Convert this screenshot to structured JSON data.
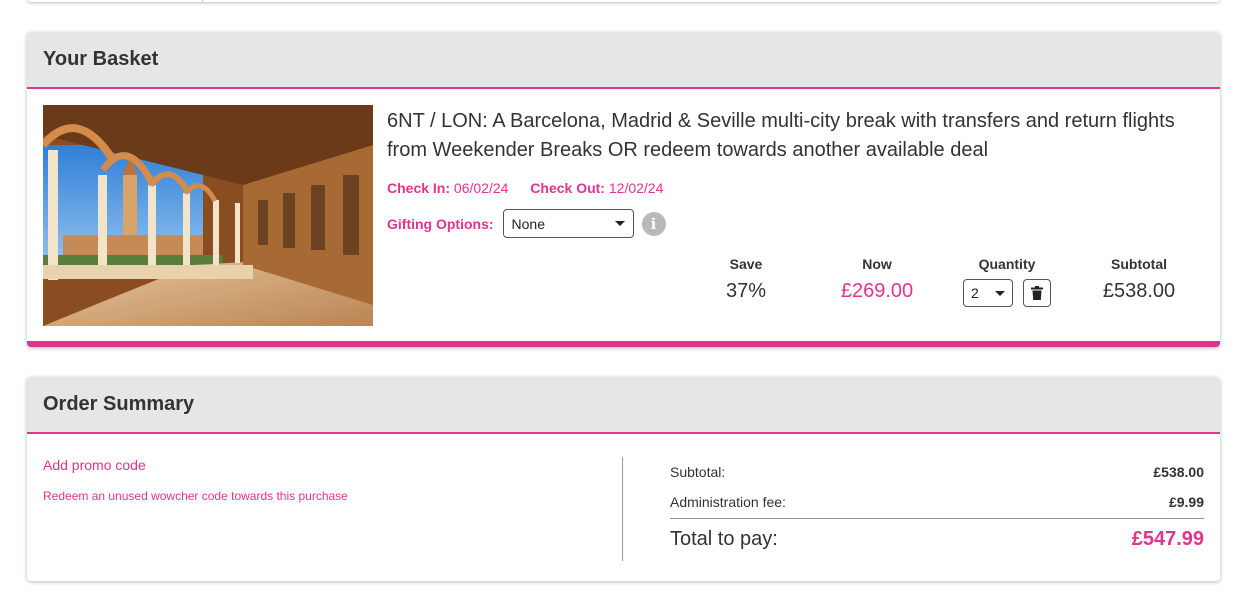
{
  "basket": {
    "header": "Your Basket",
    "deal_title": "6NT / LON: A Barcelona, Madrid & Seville multi-city break with transfers and return flights from Weekender Breaks OR redeem towards another available deal",
    "check_in_label": "Check In:",
    "check_in_value": "06/02/24",
    "check_out_label": "Check Out:",
    "check_out_value": "12/02/24",
    "gifting_label": "Gifting Options:",
    "gifting_selected": "None",
    "info_icon_glyph": "i",
    "columns": {
      "save": {
        "label": "Save",
        "value": "37%"
      },
      "now": {
        "label": "Now",
        "value": "£269.00"
      },
      "quantity": {
        "label": "Quantity",
        "value": "2"
      },
      "subtotal": {
        "label": "Subtotal",
        "value": "£538.00"
      }
    },
    "image_icon": "plaza-de-espana-arcade-photo",
    "delete_icon": "trash-icon"
  },
  "summary": {
    "header": "Order Summary",
    "promo_link": "Add promo code",
    "redeem_link": "Redeem an unused wowcher code towards this purchase",
    "subtotal_label": "Subtotal:",
    "subtotal_value": "£538.00",
    "admin_label": "Administration fee:",
    "admin_value": "£9.99",
    "total_label": "Total to pay:",
    "total_value": "£547.99"
  },
  "colors": {
    "accent": "#e0348e",
    "header_bg": "#e6e6e6",
    "text": "#333333"
  }
}
